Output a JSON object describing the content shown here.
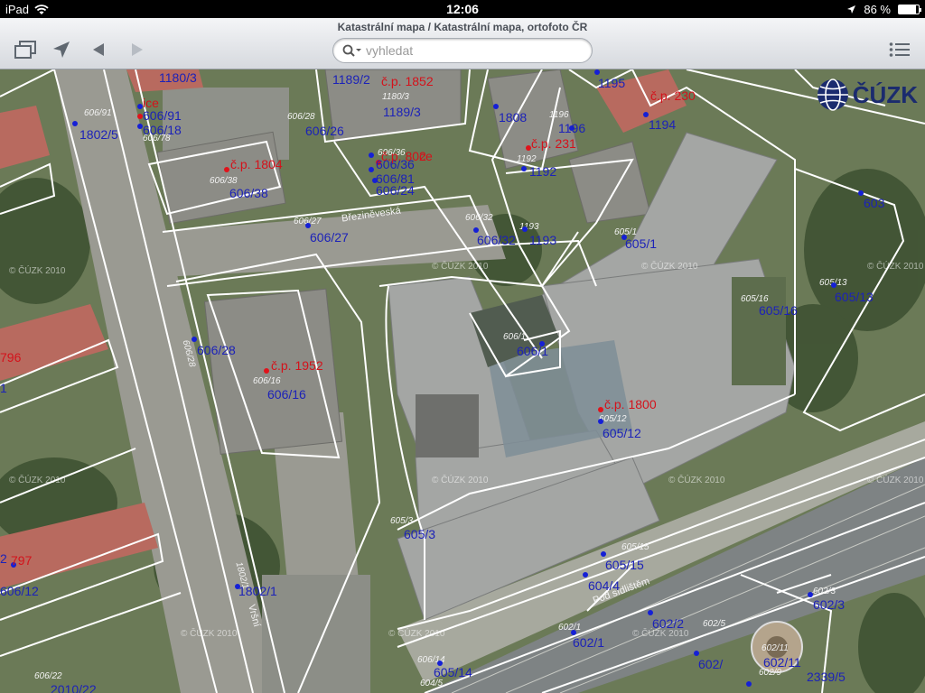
{
  "status_bar": {
    "device": "iPad",
    "time": "12:06",
    "battery_text": "86 %",
    "battery_level": 0.86
  },
  "toolbar": {
    "title": "Katastrální mapa / Katastrální mapa, ortofoto ČR",
    "search_placeholder": "vyhledat",
    "icons": {
      "pages": "pages-icon",
      "location": "location-arrow-icon",
      "back": "back-arrow-icon",
      "forward": "forward-arrow-icon",
      "list": "list-icon",
      "search": "search-icon"
    }
  },
  "logo": {
    "text": "ČÚZK"
  },
  "watermark": "© ČÚZK 2010",
  "map": {
    "parcels": [
      "1180/3",
      "606/91",
      "606/18",
      "1802/5",
      "606/26",
      "1189/2",
      "1189/3",
      "1808",
      "1196",
      "1195",
      "1194",
      "1192",
      "606/36",
      "606/81",
      "606/24",
      "606/38",
      "606/27",
      "606/32",
      "1193",
      "605/1",
      "603",
      "605/13",
      "605/16",
      "606/1",
      "606/28",
      "606/16",
      "605/12",
      "605/3",
      "605/15",
      "604/4",
      "602/2",
      "602/3",
      "602/1",
      "602/5",
      "602/11",
      "2339/5",
      "605/14",
      "1802/1",
      "1",
      "2",
      "606/12",
      "2010/22",
      "602/"
    ],
    "small_parcels": [
      "606/91",
      "606/78",
      "606/28",
      "1180/3",
      "1190",
      "1196",
      "606/36",
      "606/38",
      "606/27",
      "606/32",
      "1192",
      "1193",
      "605/1",
      "605/16",
      "606/1",
      "605/13",
      "606/28",
      "606/16",
      "605/12",
      "605/3",
      "605/15",
      "602/3",
      "602/1",
      "602/5",
      "602/11",
      "602/9",
      "606/22",
      "606/14",
      "604/5",
      "1802/1"
    ],
    "building_numbers": [
      "č.p. 1852",
      "č.p. 1804",
      "č.p. 230",
      "č.p. 231",
      "č.p. 1952",
      "č.p. 1800",
      "č.p. 1797",
      "č.p. 796",
      "č.p. 802",
      "č.p. 863"
    ],
    "streets": [
      "Březiněveská",
      "Pod sídlištěm",
      "Vršní"
    ],
    "visible_marks": [
      "ice",
      "ce",
      "796",
      "1",
      "9",
      "2",
      "797",
      "3",
      "č.p. 1852"
    ]
  }
}
